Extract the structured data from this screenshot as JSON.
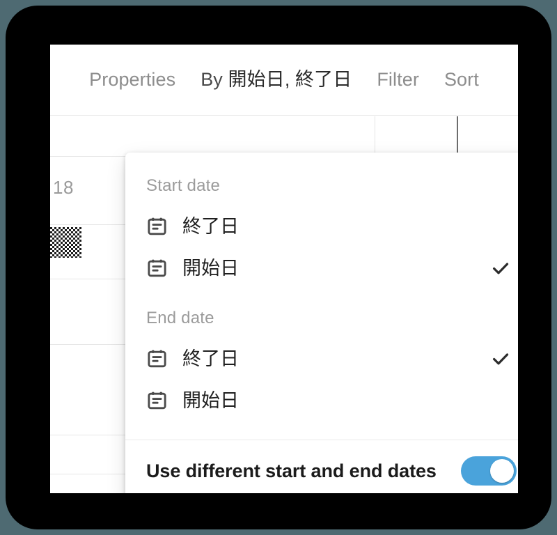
{
  "toolbar": {
    "items": [
      {
        "label": "Properties",
        "style": "muted"
      },
      {
        "label": "By 開始日, 終了日",
        "style": "strong"
      },
      {
        "label": "Filter",
        "style": "muted"
      },
      {
        "label": "Sort",
        "style": "muted"
      }
    ],
    "properties_label": "Properties",
    "group_by_prefix": "By",
    "group_by_value": "開始日, 終了日",
    "filter_label": "Filter",
    "sort_label": "Sort"
  },
  "background": {
    "day_number": "18"
  },
  "menu": {
    "start_section": {
      "header": "Start date",
      "options": [
        {
          "label": "終了日",
          "icon": "calendar-icon",
          "checked": false
        },
        {
          "label": "開始日",
          "icon": "calendar-icon",
          "checked": true
        }
      ]
    },
    "end_section": {
      "header": "End date",
      "options": [
        {
          "label": "終了日",
          "icon": "calendar-icon",
          "checked": true
        },
        {
          "label": "開始日",
          "icon": "calendar-icon",
          "checked": false
        }
      ]
    },
    "toggle_row": {
      "label": "Use different start and end dates",
      "state": "on",
      "accent_color": "#4aa3db"
    },
    "check_glyph": "✓"
  },
  "colors": {
    "page_background": "#4e6a72",
    "device_bezel": "#000000",
    "app_background": "#ffffff",
    "accent_blue": "#4aa3db",
    "muted_text": "#8d8d8d",
    "primary_text": "#1f1f1f"
  }
}
